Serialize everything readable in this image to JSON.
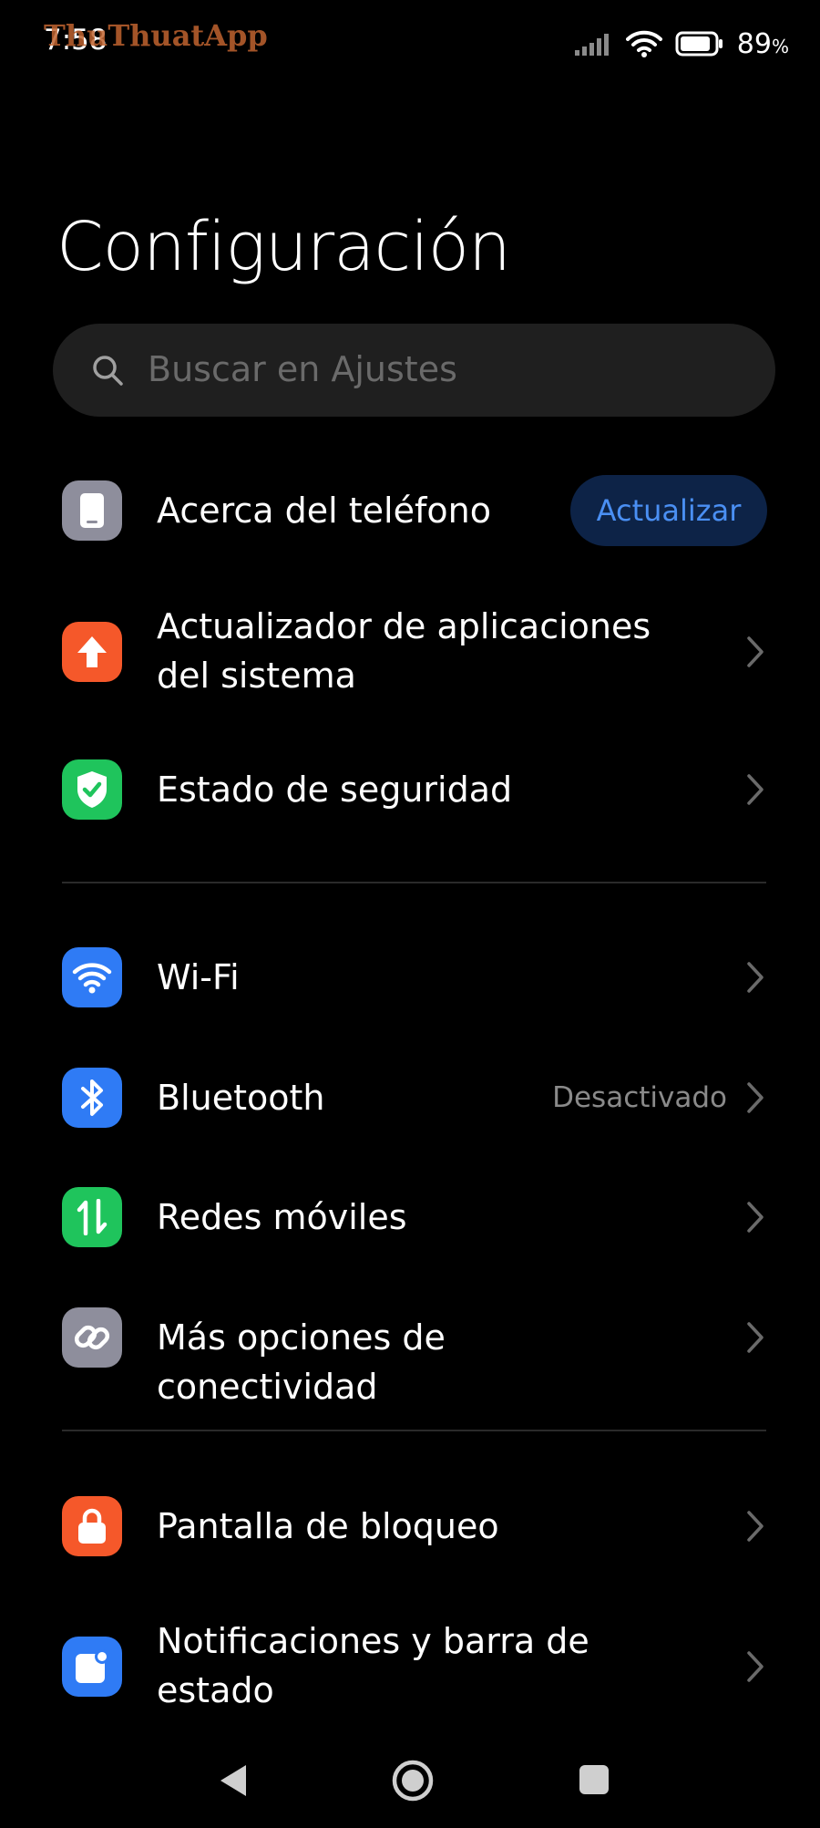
{
  "status": {
    "time": "7:58",
    "watermark": "ThuThuatApp",
    "battery_value": "89",
    "battery_unit": "%",
    "battery_level": 0.89
  },
  "header": {
    "title": "Configuración"
  },
  "search": {
    "placeholder": "Buscar en Ajustes"
  },
  "sections": [
    {
      "items": [
        {
          "label": "Acerca del teléfono",
          "icon": "phone-icon",
          "icon_color": "#8e8e9c",
          "action_label": "Actualizar"
        },
        {
          "label": "Actualizador de aplicaciones del sistema",
          "icon": "arrow-up-icon",
          "icon_color": "#f5582a"
        },
        {
          "label": "Estado de seguridad",
          "icon": "shield-check-icon",
          "icon_color": "#1fc45c"
        }
      ]
    },
    {
      "items": [
        {
          "label": "Wi-Fi",
          "icon": "wifi-icon",
          "icon_color": "#2f7bf5"
        },
        {
          "label": "Bluetooth",
          "icon": "bluetooth-icon",
          "icon_color": "#2f7bf5",
          "value": "Desactivado"
        },
        {
          "label": "Redes móviles",
          "icon": "mobile-data-icon",
          "icon_color": "#1fc45c"
        },
        {
          "label": "Más opciones de conectividad",
          "icon": "link-icon",
          "icon_color": "#8e8e9c"
        }
      ]
    },
    {
      "items": [
        {
          "label": "Pantalla de bloqueo",
          "icon": "lock-icon",
          "icon_color": "#f5582a"
        },
        {
          "label": "Notificaciones y barra de estado",
          "icon": "notification-icon",
          "icon_color": "#2f7bf5"
        }
      ]
    }
  ],
  "nav": {
    "back": "back-icon",
    "home": "home-icon",
    "recents": "recents-icon"
  }
}
